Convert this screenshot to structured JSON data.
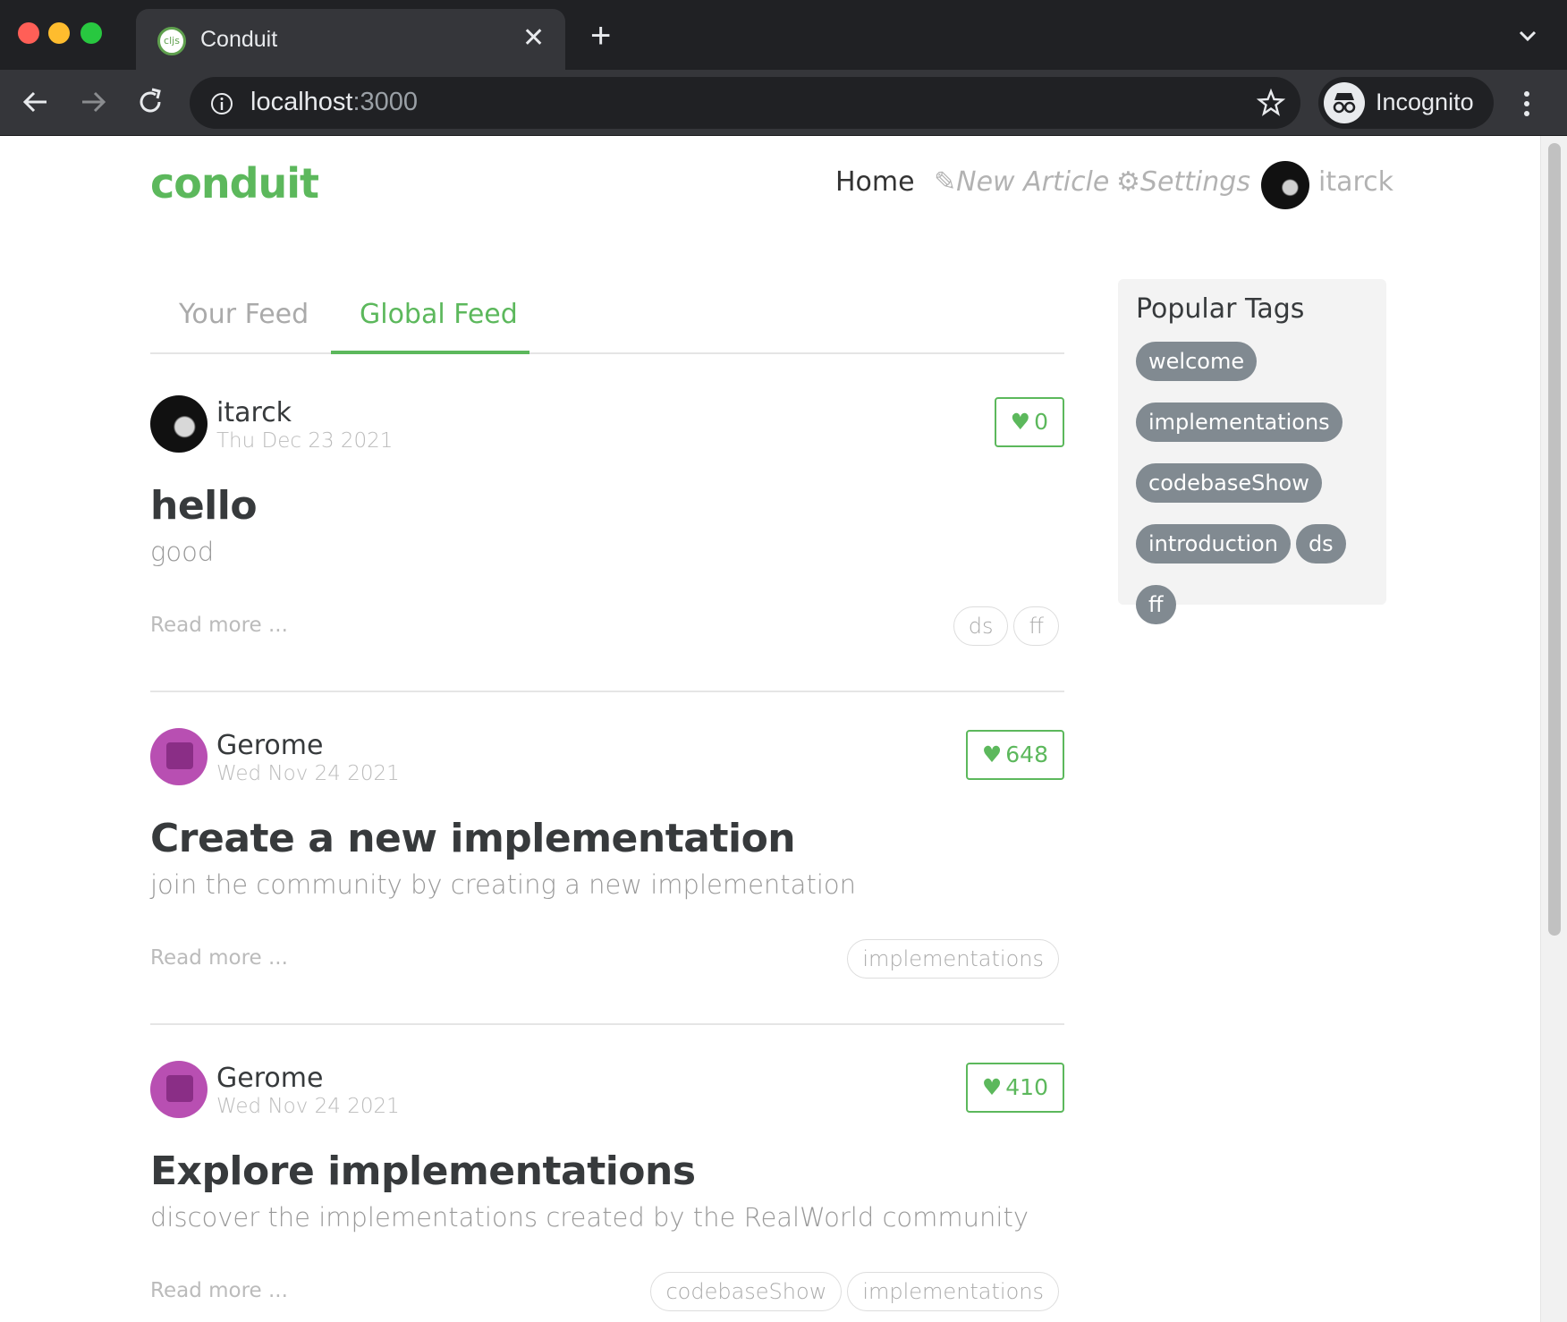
{
  "browser": {
    "tab_title": "Conduit",
    "tab_favicon_text": "cljs",
    "url_host": "localhost",
    "url_port": ":3000",
    "incognito_label": "Incognito"
  },
  "nav": {
    "brand": "conduit",
    "home": "Home",
    "new_article": "New Article",
    "settings": "Settings",
    "username": "itarck"
  },
  "feed_tabs": {
    "your_feed": "Your Feed",
    "global_feed": "Global Feed",
    "active": "Global Feed"
  },
  "articles": [
    {
      "author": "itarck",
      "date": "Thu Dec 23 2021",
      "favorites": "0",
      "title": "hello",
      "description": "good",
      "read_more": "Read more ...",
      "tags": [
        "ds",
        "ff"
      ]
    },
    {
      "author": "Gerome",
      "date": "Wed Nov 24 2021",
      "favorites": "648",
      "title": "Create a new implementation",
      "description": "join the community by creating a new implementation",
      "read_more": "Read more ...",
      "tags": [
        "implementations"
      ]
    },
    {
      "author": "Gerome",
      "date": "Wed Nov 24 2021",
      "favorites": "410",
      "title": "Explore implementations",
      "description": "discover the implementations created by the RealWorld community",
      "read_more": "Read more ...",
      "tags": [
        "codebaseShow",
        "implementations"
      ]
    }
  ],
  "sidebar": {
    "title": "Popular Tags",
    "tags": [
      "welcome",
      "implementations",
      "codebaseShow",
      "introduction",
      "ds",
      "ff"
    ]
  },
  "colors": {
    "accent": "#5cb85c",
    "tag_pill": "#818a91",
    "chrome_dark": "#202124",
    "chrome_toolbar": "#35363a"
  },
  "icons": {
    "favorite": "heart-icon",
    "new_article": "compose-icon",
    "settings": "gear-icon"
  }
}
